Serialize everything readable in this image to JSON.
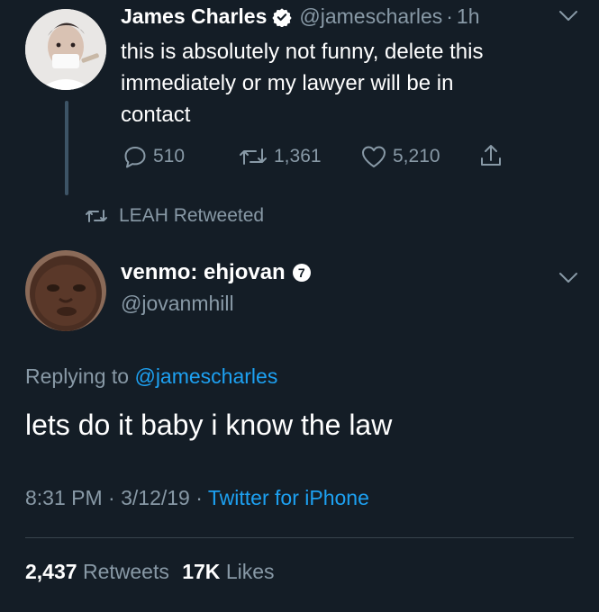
{
  "tweet1": {
    "author_name": "James Charles",
    "author_handle": "@jamescharles",
    "separator": "·",
    "time_ago": "1h",
    "text_lines": [
      "this is absolutely not funny, delete this",
      "immediately or my lawyer will be in",
      "contact"
    ],
    "actions": {
      "replies": "510",
      "retweets": "1,361",
      "likes": "5,210"
    }
  },
  "retweet_context": {
    "label": "LEAH Retweeted"
  },
  "tweet2": {
    "author_name": "venmo: ehjovan",
    "badge_number": "7",
    "author_handle": "@jovanmhill",
    "replying_prefix": "Replying to",
    "replying_to": "@jamescharles",
    "text": "lets do it baby i know the law",
    "time": "8:31 PM",
    "dot1": "·",
    "date": "3/12/19",
    "dot2": "·",
    "source": "Twitter for iPhone",
    "stats": {
      "retweets_count": "2,437",
      "retweets_label": "Retweets",
      "likes_count": "17K",
      "likes_label": "Likes"
    }
  },
  "colors": {
    "background": "#141d26",
    "text": "#ffffff",
    "muted": "#8899a6",
    "link": "#1da1f2",
    "divider": "#38444d"
  },
  "icons": {
    "verified": "verified-badge-icon",
    "chevron": "chevron-down-icon",
    "reply": "reply-icon",
    "retweet": "retweet-icon",
    "like": "heart-icon",
    "share": "share-icon"
  }
}
